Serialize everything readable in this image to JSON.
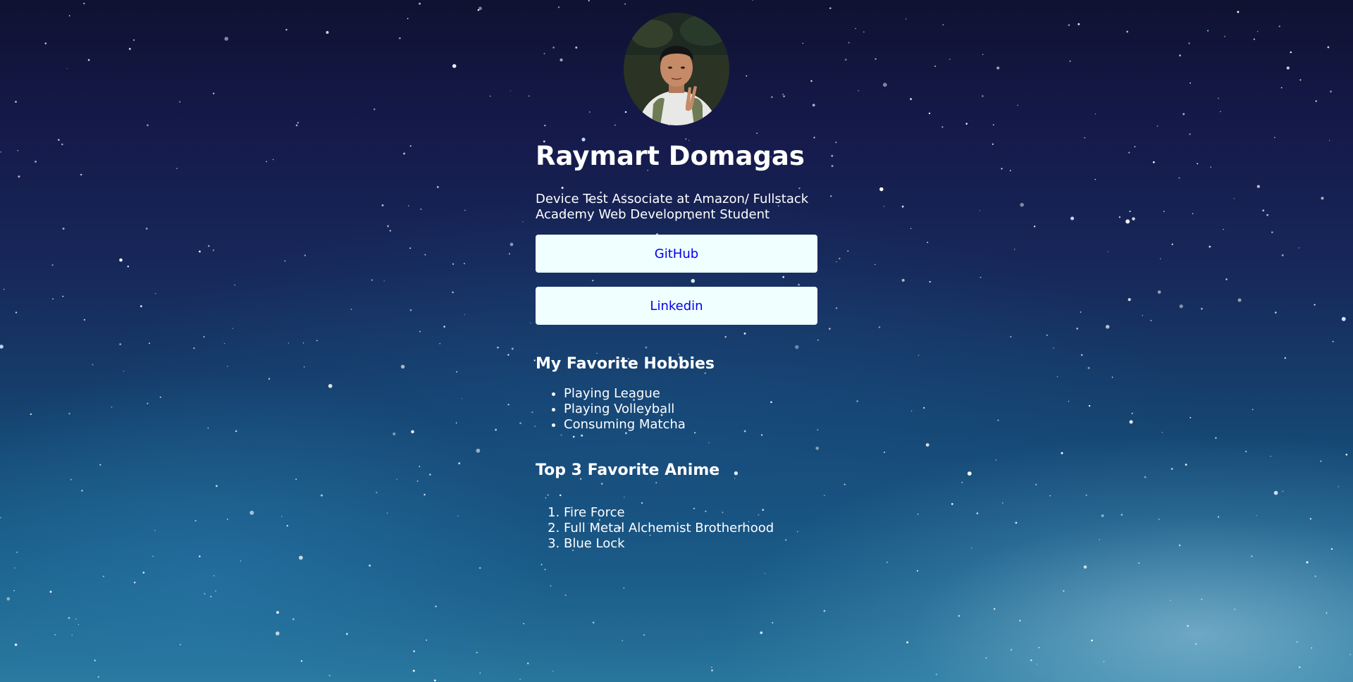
{
  "profile": {
    "name": "Raymart Domagas",
    "bio": "Device Test Associate at Amazon/ Fullstack Academy Web Development Student"
  },
  "links": [
    {
      "label": "GitHub"
    },
    {
      "label": "Linkedin"
    }
  ],
  "hobbies": {
    "title": "My Favorite Hobbies",
    "items": [
      "Playing League",
      "Playing Volleyball",
      "Consuming Matcha"
    ]
  },
  "anime": {
    "title": "Top 3 Favorite Anime",
    "items": [
      "Fire Force",
      "Full Metal Alchemist Brotherhood",
      "Blue Lock"
    ]
  },
  "colors": {
    "button_bg": "#f0ffff",
    "link_text": "#0000ee",
    "text": "#ffffff"
  }
}
